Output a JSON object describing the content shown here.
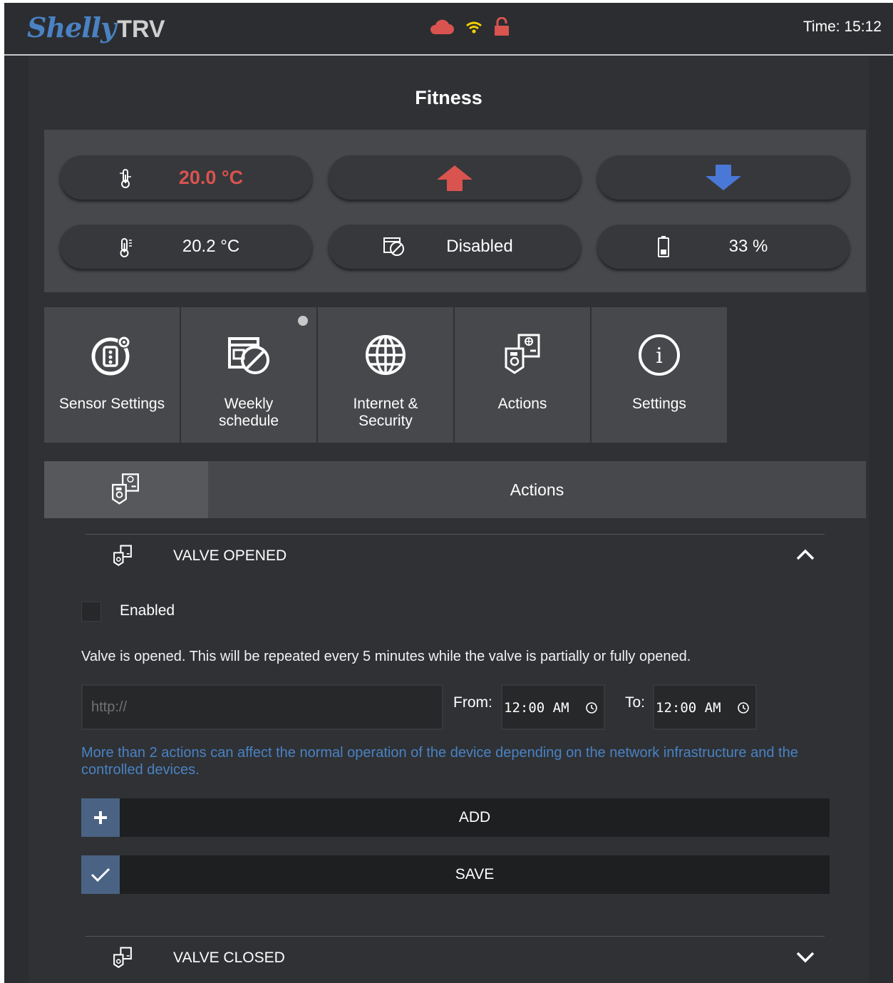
{
  "header": {
    "logo_script": "Shelly",
    "logo_product": "TRV",
    "status_icons": [
      "cloud-icon",
      "wifi-icon",
      "unlocked-icon"
    ],
    "status_colors": {
      "cloud": "#d9534f",
      "wifi": "#f5d000",
      "lock": "#d9534f"
    },
    "time_label": "Time:",
    "time_value": "15:12"
  },
  "room": {
    "title": "Fitness"
  },
  "controls": {
    "target_temperature": "20.0 °C",
    "up_button": "arrow-up-icon",
    "down_button": "arrow-down-icon",
    "current_temperature": "20.2 °C",
    "schedule_status": "Disabled",
    "battery": "33 %",
    "colors": {
      "target": "#d9534f",
      "up": "#d9534f",
      "down": "#4a78d6"
    }
  },
  "tiles": [
    {
      "label_1": "Sensor Settings",
      "label_2": "",
      "icon": "sensor-settings-icon"
    },
    {
      "label_1": "Weekly",
      "label_2": "schedule",
      "icon": "weekly-schedule-icon"
    },
    {
      "label_1": "Internet &",
      "label_2": "Security",
      "icon": "globe-icon"
    },
    {
      "label_1": "Actions",
      "label_2": "",
      "icon": "actions-icon"
    },
    {
      "label_1": "Settings",
      "label_2": "",
      "icon": "info-icon"
    }
  ],
  "section": {
    "title": "Actions"
  },
  "accordion": {
    "opened": {
      "title": "VALVE OPENED",
      "expanded": true
    },
    "closed": {
      "title": "VALVE CLOSED",
      "expanded": false
    }
  },
  "action_form": {
    "enabled_label": "Enabled",
    "enabled": false,
    "description": "Valve is opened. This will be repeated every 5 minutes while the valve is partially or fully opened.",
    "url_placeholder": "http://",
    "url_value": "",
    "from_label": "From:",
    "from_value": "12:00 AM",
    "to_label": "To:",
    "to_value": "12:00 AM",
    "warning": "More than 2 actions can affect the normal operation of the device depending on the network infrastructure and the controlled devices.",
    "add_label": "ADD",
    "save_label": "SAVE"
  }
}
